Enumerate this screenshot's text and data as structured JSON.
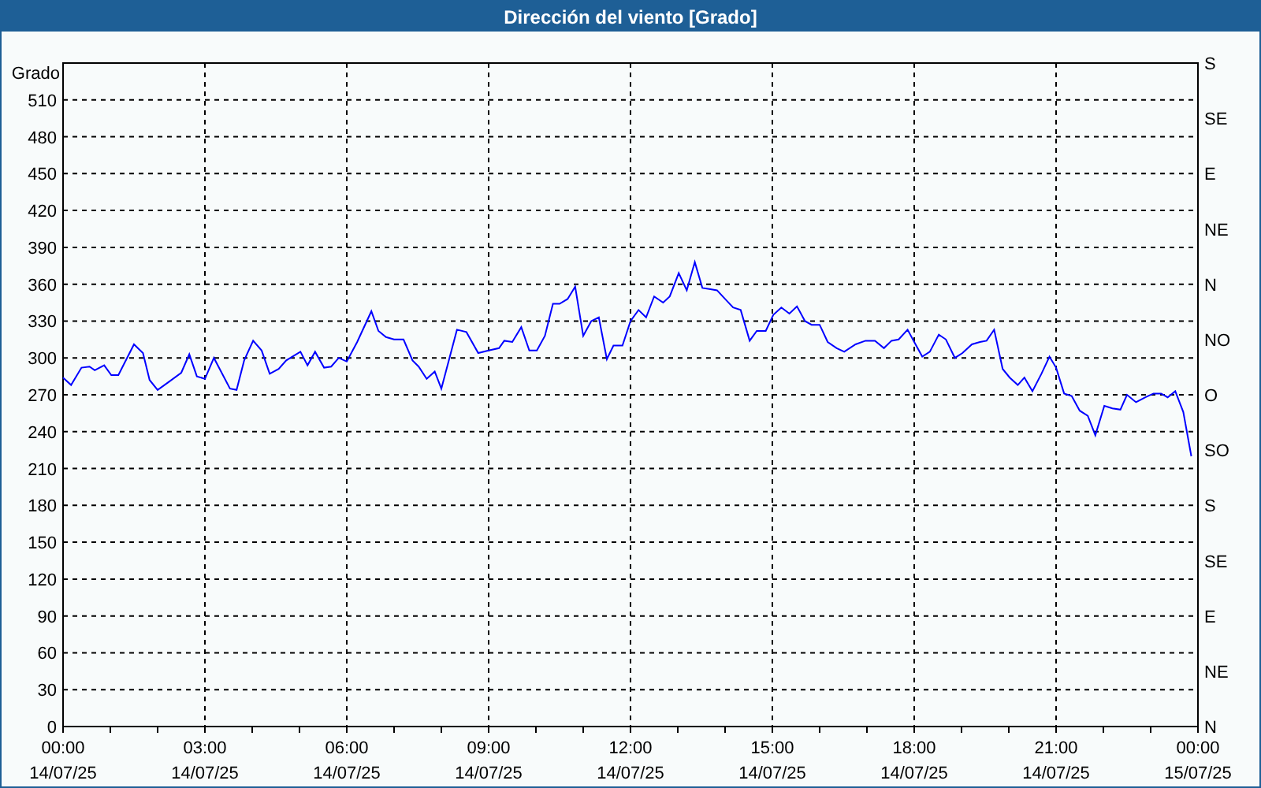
{
  "window": {
    "title": "Dirección del viento [Grado]"
  },
  "x_axis_dates": [
    "14/07/25",
    "14/07/25",
    "14/07/25",
    "14/07/25",
    "14/07/25",
    "14/07/25",
    "14/07/25",
    "14/07/25",
    "15/07/25"
  ],
  "compass_axis": {
    "labels": [
      "S",
      "SE",
      "E",
      "NE",
      "N",
      "NO",
      "O",
      "SO",
      "S",
      "SE",
      "E",
      "NE",
      "N"
    ]
  },
  "chart_data": {
    "type": "line",
    "grid": true,
    "ylabel": "Grado",
    "xlim": [
      0,
      24
    ],
    "ylim": [
      0,
      540
    ],
    "xticks": [
      {
        "value": 0,
        "label": "00:00"
      },
      {
        "value": 3,
        "label": "03:00"
      },
      {
        "value": 6,
        "label": "06:00"
      },
      {
        "value": 9,
        "label": "09:00"
      },
      {
        "value": 12,
        "label": "12:00"
      },
      {
        "value": 15,
        "label": "15:00"
      },
      {
        "value": 18,
        "label": "18:00"
      },
      {
        "value": 21,
        "label": "21:00"
      },
      {
        "value": 24,
        "label": "00:00"
      }
    ],
    "yticks": [
      0,
      30,
      60,
      90,
      120,
      150,
      180,
      210,
      240,
      270,
      300,
      330,
      360,
      390,
      420,
      450,
      480,
      510
    ],
    "x": [
      0,
      0.17,
      0.39,
      0.56,
      0.67,
      0.87,
      1.02,
      1.17,
      1.5,
      1.69,
      1.83,
      2,
      2.22,
      2.5,
      2.67,
      2.83,
      3,
      3.19,
      3.53,
      3.67,
      3.83,
      4.02,
      4.2,
      4.37,
      4.56,
      4.72,
      5.02,
      5.17,
      5.33,
      5.52,
      5.67,
      5.83,
      6,
      6.22,
      6.52,
      6.67,
      6.83,
      7,
      7.2,
      7.39,
      7.52,
      7.69,
      7.86,
      8,
      8.33,
      8.53,
      8.78,
      9,
      9.22,
      9.33,
      9.5,
      9.69,
      9.86,
      10.02,
      10.19,
      10.36,
      10.5,
      10.67,
      10.83,
      11,
      11.17,
      11.33,
      11.5,
      11.64,
      11.83,
      12,
      12.17,
      12.33,
      12.5,
      12.69,
      12.83,
      13.02,
      13.19,
      13.36,
      13.52,
      13.69,
      13.83,
      14,
      14.17,
      14.33,
      14.52,
      14.67,
      14.86,
      15.02,
      15.19,
      15.36,
      15.52,
      15.69,
      15.83,
      16,
      16.17,
      16.36,
      16.52,
      16.76,
      16.97,
      17.17,
      17.36,
      17.52,
      17.67,
      17.86,
      18,
      18.17,
      18.33,
      18.52,
      18.67,
      18.86,
      19.02,
      19.22,
      19.39,
      19.53,
      19.69,
      19.87,
      20.02,
      20.19,
      20.33,
      20.5,
      20.69,
      20.86,
      21,
      21.17,
      21.33,
      21.5,
      21.67,
      21.83,
      22.02,
      22.19,
      22.36,
      22.5,
      22.69,
      22.89,
      23.06,
      23.22,
      23.36,
      23.52,
      23.69,
      23.86
    ],
    "series": [
      {
        "color": "#0000ff",
        "values": [
          284,
          278,
          292,
          293,
          290,
          294,
          286,
          286,
          311,
          304,
          282,
          274,
          280,
          288,
          303,
          285,
          283,
          300,
          275,
          274,
          298,
          314,
          306,
          287,
          291,
          298,
          305,
          294,
          305,
          292,
          293,
          300,
          297,
          313,
          338,
          322,
          317,
          315,
          315,
          298,
          293,
          283,
          289,
          275,
          323,
          321,
          304,
          306,
          308,
          314,
          313,
          325,
          306,
          306,
          318,
          344,
          344,
          348,
          358,
          318,
          330,
          333,
          299,
          310,
          310,
          330,
          339,
          333,
          350,
          345,
          350,
          369,
          355,
          378,
          357,
          356,
          355,
          348,
          341,
          339,
          314,
          322,
          322,
          335,
          341,
          336,
          342,
          330,
          327,
          327,
          313,
          308,
          305,
          311,
          314,
          314,
          308,
          314,
          315,
          323,
          313,
          301,
          305,
          319,
          315,
          300,
          304,
          311,
          313,
          314,
          323,
          291,
          284,
          278,
          284,
          273,
          287,
          301,
          292,
          271,
          269,
          257,
          253,
          237,
          261,
          259,
          258,
          270,
          264,
          268,
          271,
          271,
          268,
          273,
          256,
          220
        ]
      }
    ]
  }
}
